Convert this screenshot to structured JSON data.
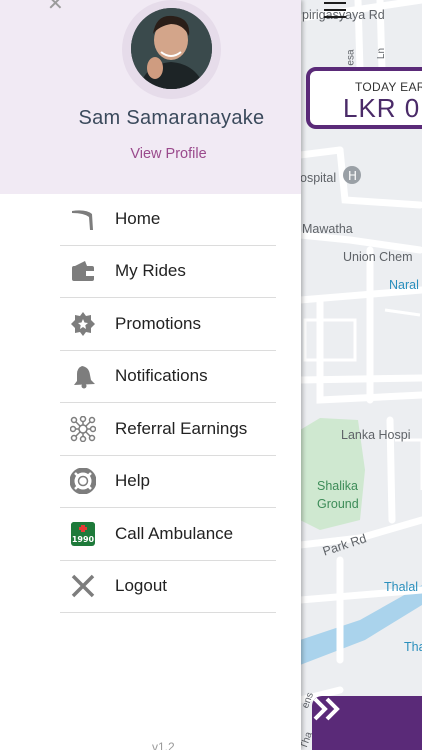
{
  "app": {
    "version": "v1.2"
  },
  "drawer": {
    "user_name": "Sam Samaranayake",
    "view_profile_label": "View Profile",
    "menu": [
      {
        "label": "Home",
        "icon": "home-icon"
      },
      {
        "label": "My Rides",
        "icon": "wallet-icon"
      },
      {
        "label": "Promotions",
        "icon": "promotion-badge-icon"
      },
      {
        "label": "Notifications",
        "icon": "bell-icon"
      },
      {
        "label": "Referral Earnings",
        "icon": "referral-network-icon"
      },
      {
        "label": "Help",
        "icon": "help-lifebuoy-icon"
      },
      {
        "label": "Call Ambulance",
        "icon": "ambulance-1990-icon"
      },
      {
        "label": "Logout",
        "icon": "logout-x-icon"
      }
    ],
    "ambulance_badge_number": "1990"
  },
  "map": {
    "labels": [
      "pirigasyaya Rd",
      "esa",
      "Ln",
      "ospital",
      "Mawatha",
      "Union Chem",
      "Naral",
      "Lanka Hospi",
      "Shalika",
      "Ground",
      "Park Rd",
      "Thalal",
      "Tha",
      "ens",
      "Tha"
    ]
  },
  "earnings": {
    "title": "TODAY EAR",
    "value": "LKR 0"
  },
  "colors": {
    "brand_purple": "#5a2a78",
    "header_bg": "#f1eaf4",
    "link_color": "#9a4a8c",
    "park_green": "#cfe8d0",
    "water_blue": "#aad3ec"
  }
}
